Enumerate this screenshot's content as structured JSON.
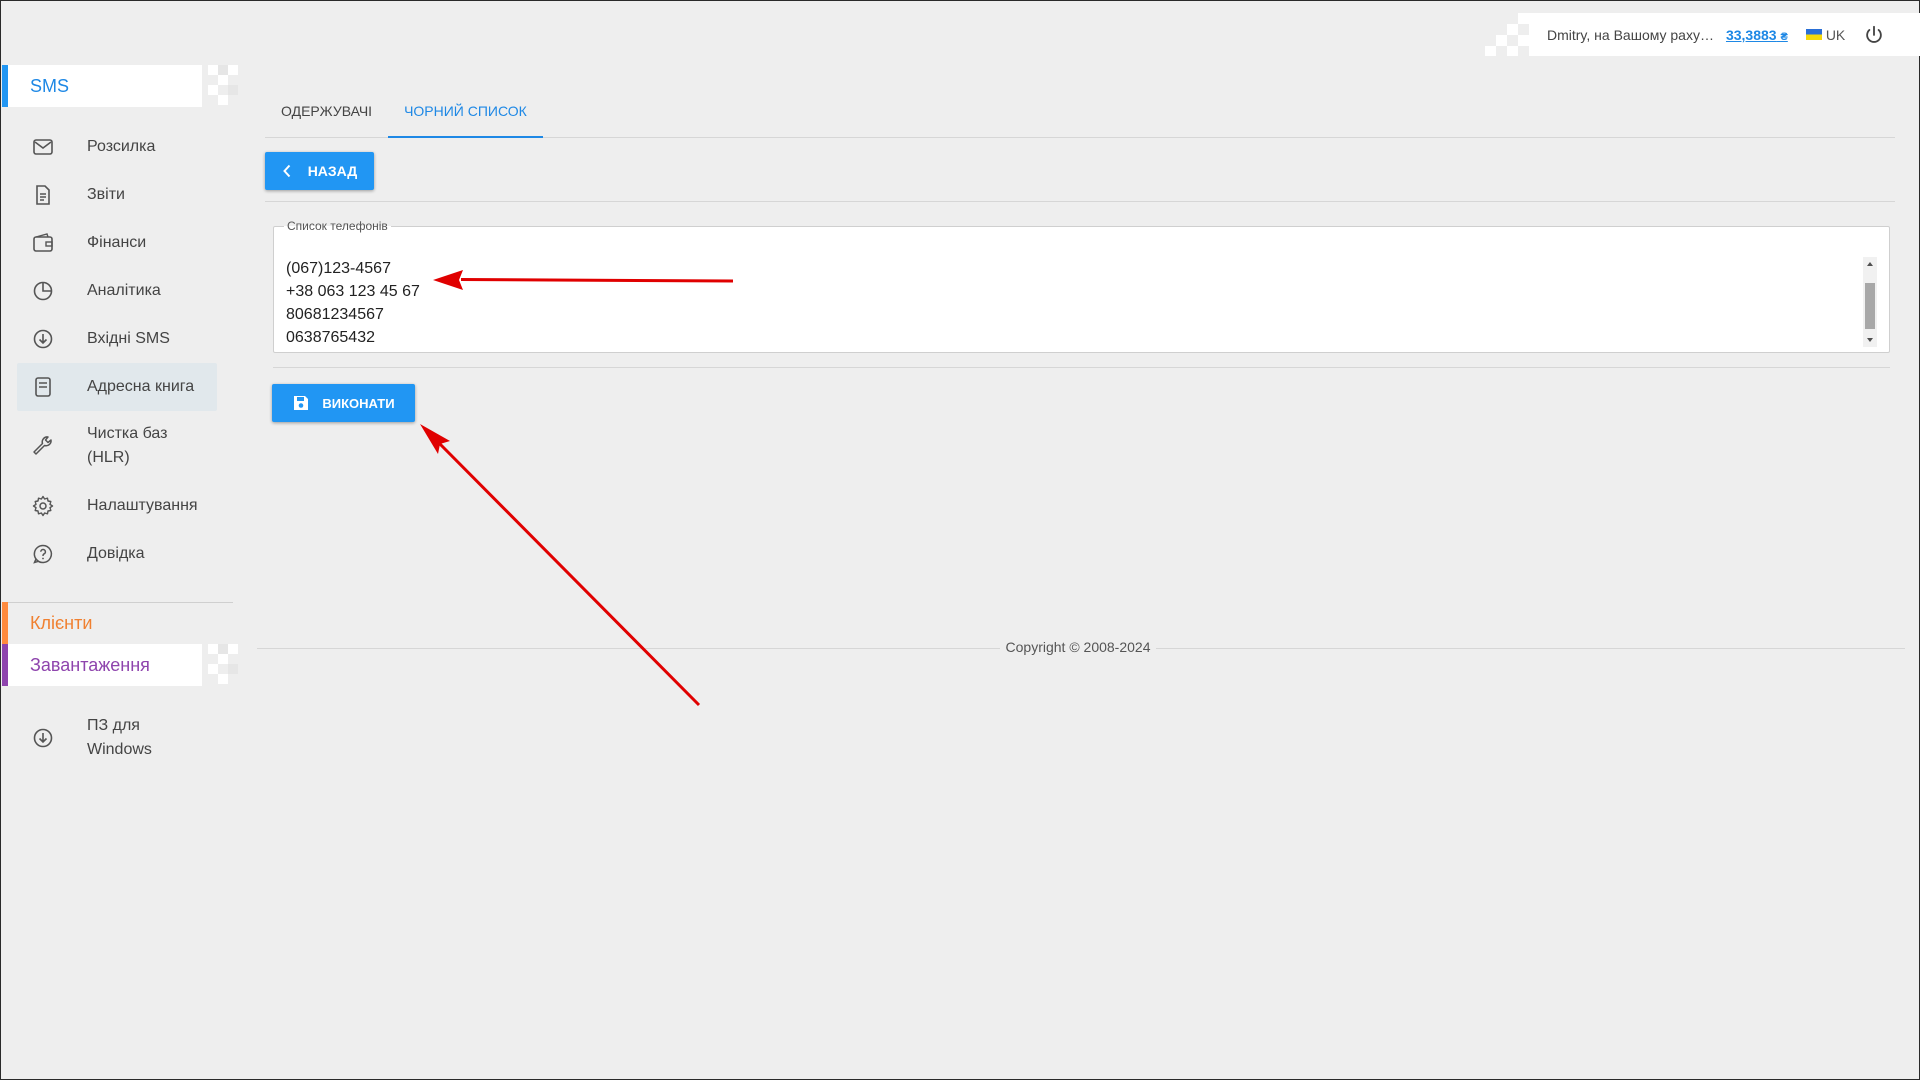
{
  "header": {
    "user_text": "Dmitry, на Вашому раху…",
    "balance": "33,3883",
    "currency": "₴",
    "language": "UK"
  },
  "sidebar": {
    "sms_title": "SMS",
    "items": [
      {
        "label": "Розсилка",
        "icon": "envelope-icon"
      },
      {
        "label": "Звіти",
        "icon": "document-icon"
      },
      {
        "label": "Фінанси",
        "icon": "wallet-icon"
      },
      {
        "label": "Аналітика",
        "icon": "pie-chart-icon"
      },
      {
        "label": "Вхідні SMS",
        "icon": "download-circle-icon"
      },
      {
        "label": "Адресна книга",
        "icon": "address-book-icon",
        "active": true
      },
      {
        "label": "Чистка баз (HLR)",
        "icon": "wrench-icon"
      },
      {
        "label": "Налаштування",
        "icon": "gear-icon"
      },
      {
        "label": "Довідка",
        "icon": "help-icon"
      }
    ],
    "clients_title": "Клієнти",
    "downloads_title": "Завантаження",
    "download_items": [
      {
        "label": "ПЗ для Windows",
        "icon": "download-circle-icon"
      }
    ]
  },
  "tabs": [
    {
      "label": "Одержувачі"
    },
    {
      "label": "Чорний список",
      "active": true
    }
  ],
  "back_button": "Назад",
  "phones": {
    "legend": "Список телефонів",
    "lines": [
      "(067)123-4567",
      "+38 063 123 45 67",
      "80681234567",
      "0638765432"
    ]
  },
  "execute_button": "Виконати",
  "footer": {
    "copyright": "Copyright © 2008-2024"
  },
  "colors": {
    "accent": "#2196f3",
    "clients": "#ff8a3d",
    "downloads": "#8e44ad",
    "annotation": "#e00000"
  }
}
